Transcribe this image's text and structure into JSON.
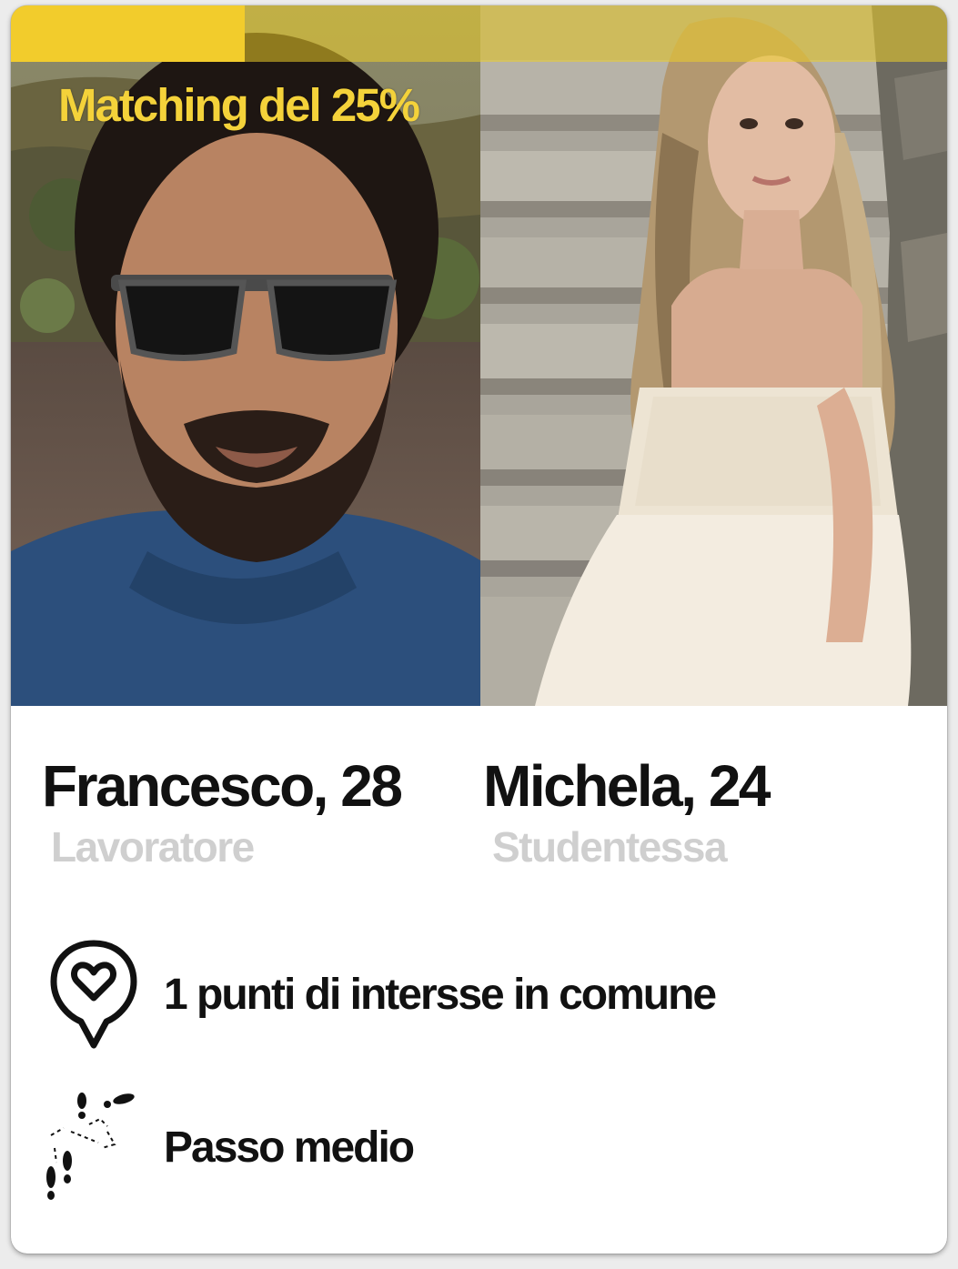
{
  "match": {
    "label": "Matching del 25%",
    "percent": 25,
    "color": "#f2cc2c"
  },
  "people": [
    {
      "name_age": "Francesco, 28",
      "role": "Lavoratore"
    },
    {
      "name_age": "Michela, 24",
      "role": "Studentessa"
    }
  ],
  "details": {
    "interests_text": "1 punti di intersse in comune",
    "interests_icon": "heart-location-pin-icon",
    "pace_text": "Passo medio",
    "pace_icon": "footsteps-icon"
  }
}
